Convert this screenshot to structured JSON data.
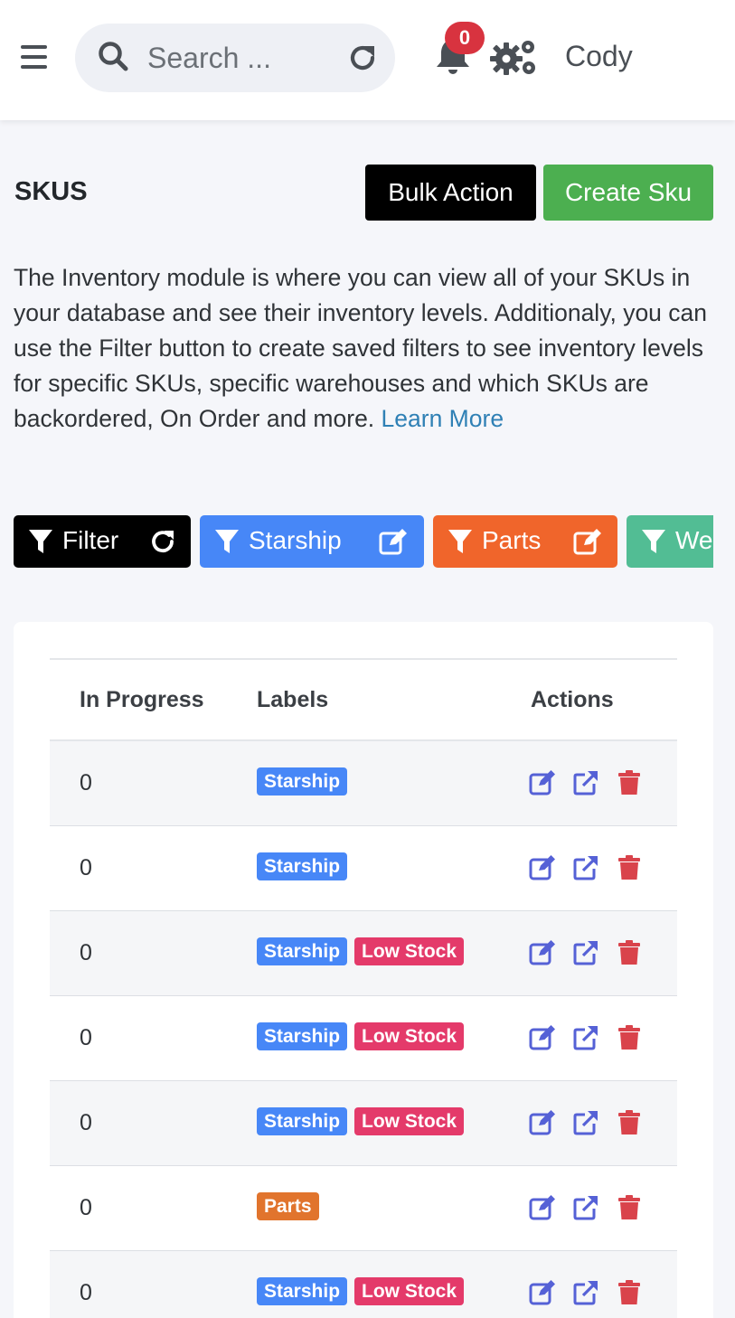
{
  "header": {
    "search_placeholder": "Search ...",
    "notification_count": "0",
    "username": "Cody"
  },
  "page": {
    "title": "SKUS",
    "bulk_action_label": "Bulk Action",
    "create_label": "Create Sku",
    "description": "The Inventory module is where you can view all of your SKUs in your database and see their inventory levels. Additionaly, you can use the Filter button to create saved filters to see inventory levels for specific SKUs, specific warehouses and which SKUs are backordered, On Order and more.",
    "learn_more": "Learn More"
  },
  "filters": {
    "main": "Filter",
    "chips": [
      {
        "label": "Starship",
        "color": "#4787f7"
      },
      {
        "label": "Parts",
        "color": "#f0652b"
      },
      {
        "label": "We",
        "color": "#52bd94"
      }
    ]
  },
  "table": {
    "columns": [
      "In Progress",
      "Labels",
      "Actions"
    ],
    "rows": [
      {
        "in_progress": "0",
        "labels": [
          "Starship"
        ]
      },
      {
        "in_progress": "0",
        "labels": [
          "Starship"
        ]
      },
      {
        "in_progress": "0",
        "labels": [
          "Starship",
          "Low Stock"
        ]
      },
      {
        "in_progress": "0",
        "labels": [
          "Starship",
          "Low Stock"
        ]
      },
      {
        "in_progress": "0",
        "labels": [
          "Starship",
          "Low Stock"
        ]
      },
      {
        "in_progress": "0",
        "labels": [
          "Parts"
        ]
      },
      {
        "in_progress": "0",
        "labels": [
          "Starship",
          "Low Stock"
        ]
      }
    ],
    "label_colors": {
      "Starship": "#4787f7",
      "Low Stock": "#e43a6a",
      "Parts": "#e1742d"
    },
    "action_icons": [
      "edit-icon",
      "external-link-icon",
      "trash-icon"
    ]
  },
  "colors": {
    "accent_blue": "#4787f7",
    "success_green": "#4caf50",
    "danger_red": "#d8333f",
    "action_blue": "#5561d6",
    "trash_red": "#d9434b"
  }
}
